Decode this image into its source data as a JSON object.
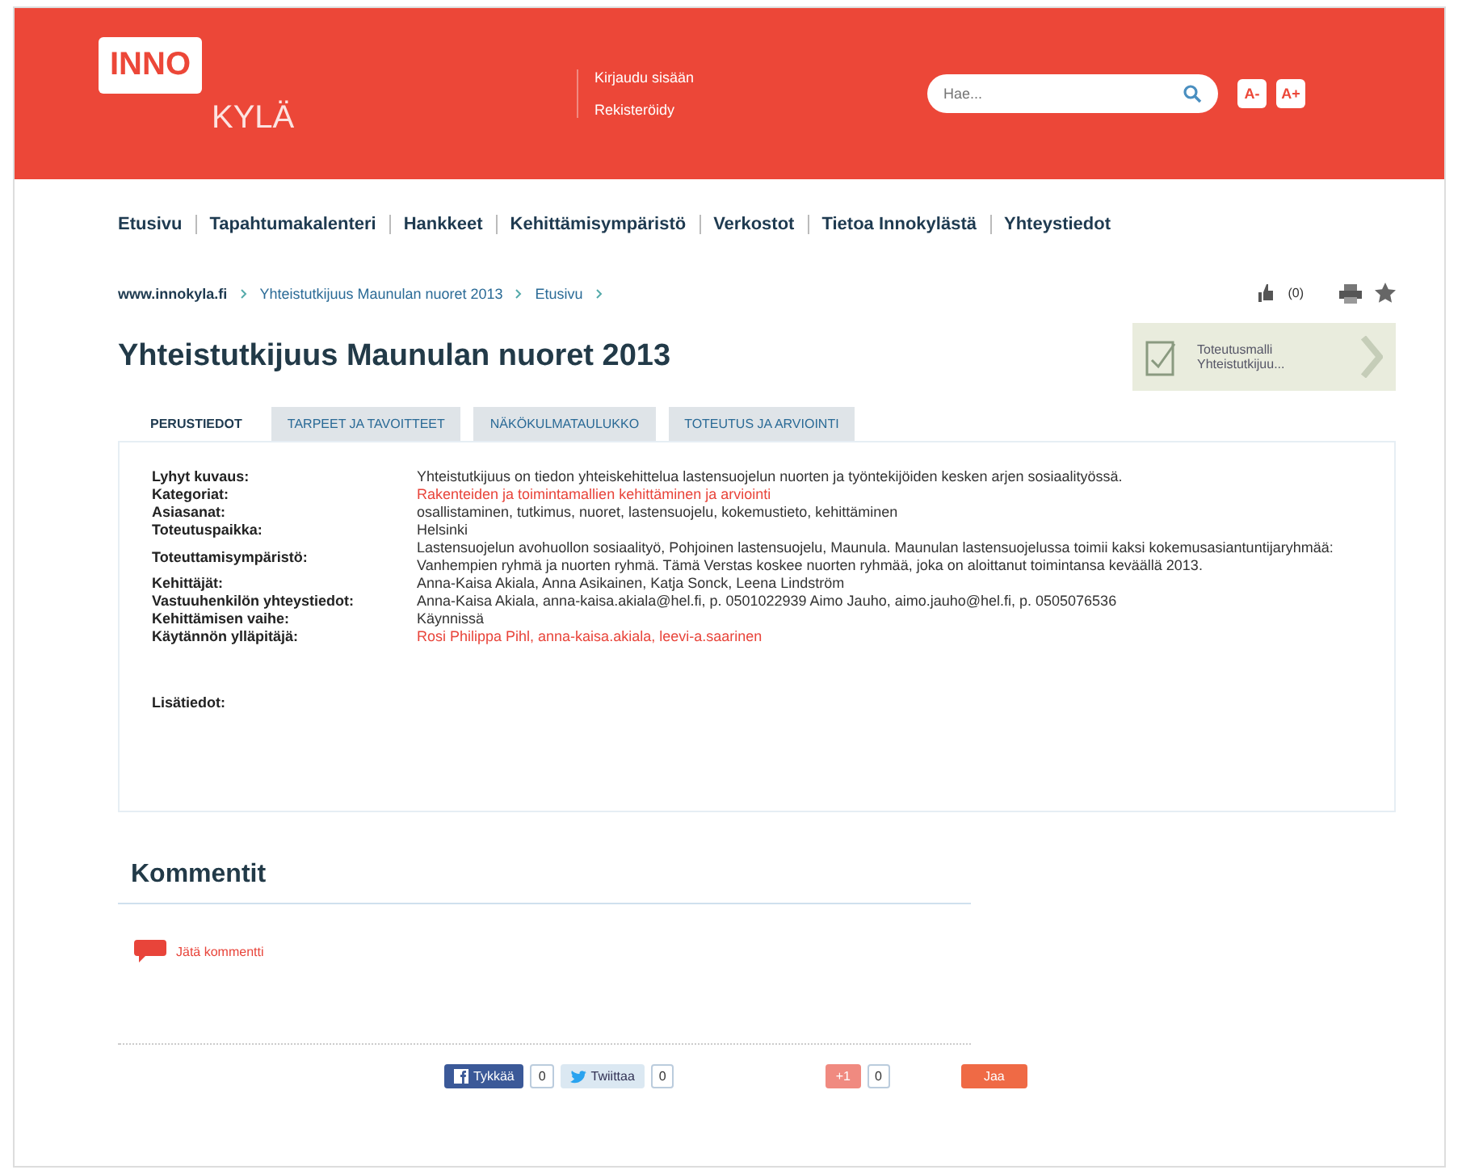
{
  "header": {
    "logo_top": "INNO",
    "logo_bottom": "KYLÄ",
    "links": [
      "Kirjaudu sisään",
      "Rekisteröidy"
    ],
    "search": {
      "placeholder": "Hae..."
    },
    "font_buttons": [
      "A-",
      "A+"
    ]
  },
  "nav": [
    "Etusivu",
    "Tapahtumakalenteri",
    "Hankkeet",
    "Kehittämisympäristö",
    "Verkostot",
    "Tietoa Innokylästä",
    "Yhteystiedot"
  ],
  "breadcrumb": [
    "www.innokyla.fi",
    "Yhteistutkijuus Maunulan nuoret 2013",
    "Etusivu"
  ],
  "likes": "(0)",
  "title": "Yhteistutkijuus Maunulan nuoret 2013",
  "side_card": {
    "lines": [
      "Toteutusmalli",
      "Yhteistutkijuu..."
    ]
  },
  "tabs": [
    {
      "label": "PERUSTIEDOT",
      "selected": true
    },
    {
      "label": "TARPEET JA TAVOITTEET",
      "selected": false
    },
    {
      "label": "NÄKÖKULMATAULUKKO",
      "selected": false
    },
    {
      "label": "TOTEUTUS JA ARVIOINTI",
      "selected": false
    }
  ],
  "details": [
    {
      "label": "Lyhyt kuvaus:",
      "value": "Yhteistutkijuus on tiedon yhteiskehittelua lastensuojelun nuorten ja työntekijöiden kesken arjen sosiaalityössä.",
      "kind": "text"
    },
    {
      "label": "Kategoriat:",
      "value": "Rakenteiden ja toimintamallien kehittäminen ja arviointi",
      "kind": "link"
    },
    {
      "label": "Asiasanat:",
      "value": "osallistaminen, tutkimus, nuoret, lastensuojelu, kokemustieto, kehittäminen",
      "kind": "text"
    },
    {
      "label": "Toteutuspaikka:",
      "value": "Helsinki",
      "kind": "text"
    },
    {
      "label": "Toteuttamisympäristö:",
      "value": "Lastensuojelun avohuollon sosiaalityö, Pohjoinen lastensuojelu, Maunula. Maunulan lastensuojelussa toimii kaksi kokemusasiantuntijaryhmää: Vanhempien ryhmä ja nuorten ryhmä. Tämä Verstas koskee nuorten ryhmää, joka on aloittanut toimintansa keväällä 2013.",
      "kind": "text"
    },
    {
      "label": "Kehittäjät:",
      "value": "Anna-Kaisa Akiala, Anna Asikainen, Katja Sonck, Leena Lindström",
      "kind": "text"
    },
    {
      "label": "Vastuuhenkilön yhteystiedot:",
      "value": "Anna-Kaisa Akiala, anna-kaisa.akiala@hel.fi, p. 0501022939 Aimo Jauho, aimo.jauho@hel.fi, p. 0505076536",
      "kind": "text"
    },
    {
      "label": "Kehittämisen vaihe:",
      "value": "Käynnissä",
      "kind": "text"
    },
    {
      "label": "Käytännön ylläpitäjä:",
      "value": "Rosi Philippa Pihl, anna-kaisa.akiala, leevi-a.saarinen",
      "kind": "link"
    }
  ],
  "extra_label": "Lisätiedot:",
  "comments": {
    "title": "Kommentit",
    "action": "Jätä kommentti"
  },
  "share": [
    {
      "label": "Tykkää",
      "count": "0",
      "kind": "facebook"
    },
    {
      "label": "Twiittaa",
      "count": "0",
      "kind": "twitter"
    },
    {
      "label": "+1",
      "count": "0",
      "kind": "google"
    },
    {
      "label": "Jaa",
      "kind": "share"
    }
  ]
}
